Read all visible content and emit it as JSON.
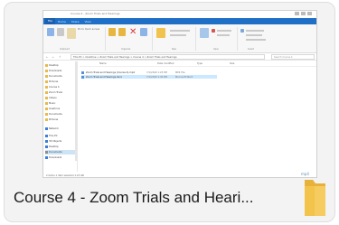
{
  "card": {
    "title": "Course 4 - Zoom Trials and Heari...",
    "type_badge": "mp4",
    "folder_icon": "folder-icon",
    "colors": {
      "folder": "#f3c44b",
      "background": "#f3f3f3",
      "accent": "#1f6fc6"
    }
  },
  "thumbnail": {
    "window_title": "Course 4 - Zoom Trials and Hearings",
    "ribbon_tabs": [
      "File",
      "Home",
      "Share",
      "View"
    ],
    "ribbon_groups": [
      "Clipboard",
      "Organize",
      "New",
      "Open",
      "Select"
    ],
    "ribbon_buttons": [
      {
        "label": "Pin to Quick access",
        "icon": "pin-icon"
      },
      {
        "label": "Copy",
        "icon": "copy-icon"
      },
      {
        "label": "Paste",
        "icon": "paste-icon"
      },
      {
        "label": "Move to",
        "icon": "move-icon"
      },
      {
        "label": "Copy to",
        "icon": "copy-to-icon"
      },
      {
        "label": "Delete",
        "icon": "delete-icon"
      },
      {
        "label": "Rename",
        "icon": "rename-icon"
      },
      {
        "label": "New folder",
        "icon": "new-folder-icon"
      },
      {
        "label": "Properties",
        "icon": "properties-icon"
      },
      {
        "label": "Select all",
        "icon": "select-all-icon"
      }
    ],
    "nav": {
      "back": "←",
      "forward": "→",
      "up": "↑"
    },
    "address": "This PC > OneDrive > Zoom Trials and Hearings > Course 4 > Zoom Trials and Hearings",
    "search_placeholder": "Search Course 4",
    "column_headers": [
      "Name",
      "Date modified",
      "Type",
      "Size"
    ],
    "files": [
      {
        "name": "Zoom Trials and Hearings (Course 4).mp4",
        "date": "7/1/2020 1:25 PM",
        "type": "MP4 File"
      },
      {
        "name": "Zoom Trials and Hearings.docx",
        "date": "7/1/2020 1:30 PM",
        "type": "Microsoft Word"
      }
    ],
    "sidebar": [
      {
        "label": "Desktop",
        "icon": "folder"
      },
      {
        "label": "Downloads",
        "icon": "folder"
      },
      {
        "label": "Documents",
        "icon": "folder"
      },
      {
        "label": "Pictures",
        "icon": "folder"
      },
      {
        "label": "Course 4",
        "icon": "folder"
      },
      {
        "label": "Zoom Trials",
        "icon": "folder"
      },
      {
        "label": "Videos",
        "icon": "folder"
      },
      {
        "label": "Music",
        "icon": "folder"
      },
      {
        "label": "OneDrive",
        "icon": "folder"
      },
      {
        "label": "Documents",
        "icon": "folder"
      },
      {
        "label": "Pictures",
        "icon": "folder"
      },
      {
        "label": "Network",
        "icon": "blue"
      },
      {
        "label": "This PC",
        "icon": "blue"
      },
      {
        "label": "3D Objects",
        "icon": "blue"
      },
      {
        "label": "Desktop",
        "icon": "blue"
      },
      {
        "label": "Documents",
        "icon": "grey"
      },
      {
        "label": "Downloads",
        "icon": "blue"
      }
    ],
    "status": "2 items   1 item selected  1.23 GB"
  }
}
